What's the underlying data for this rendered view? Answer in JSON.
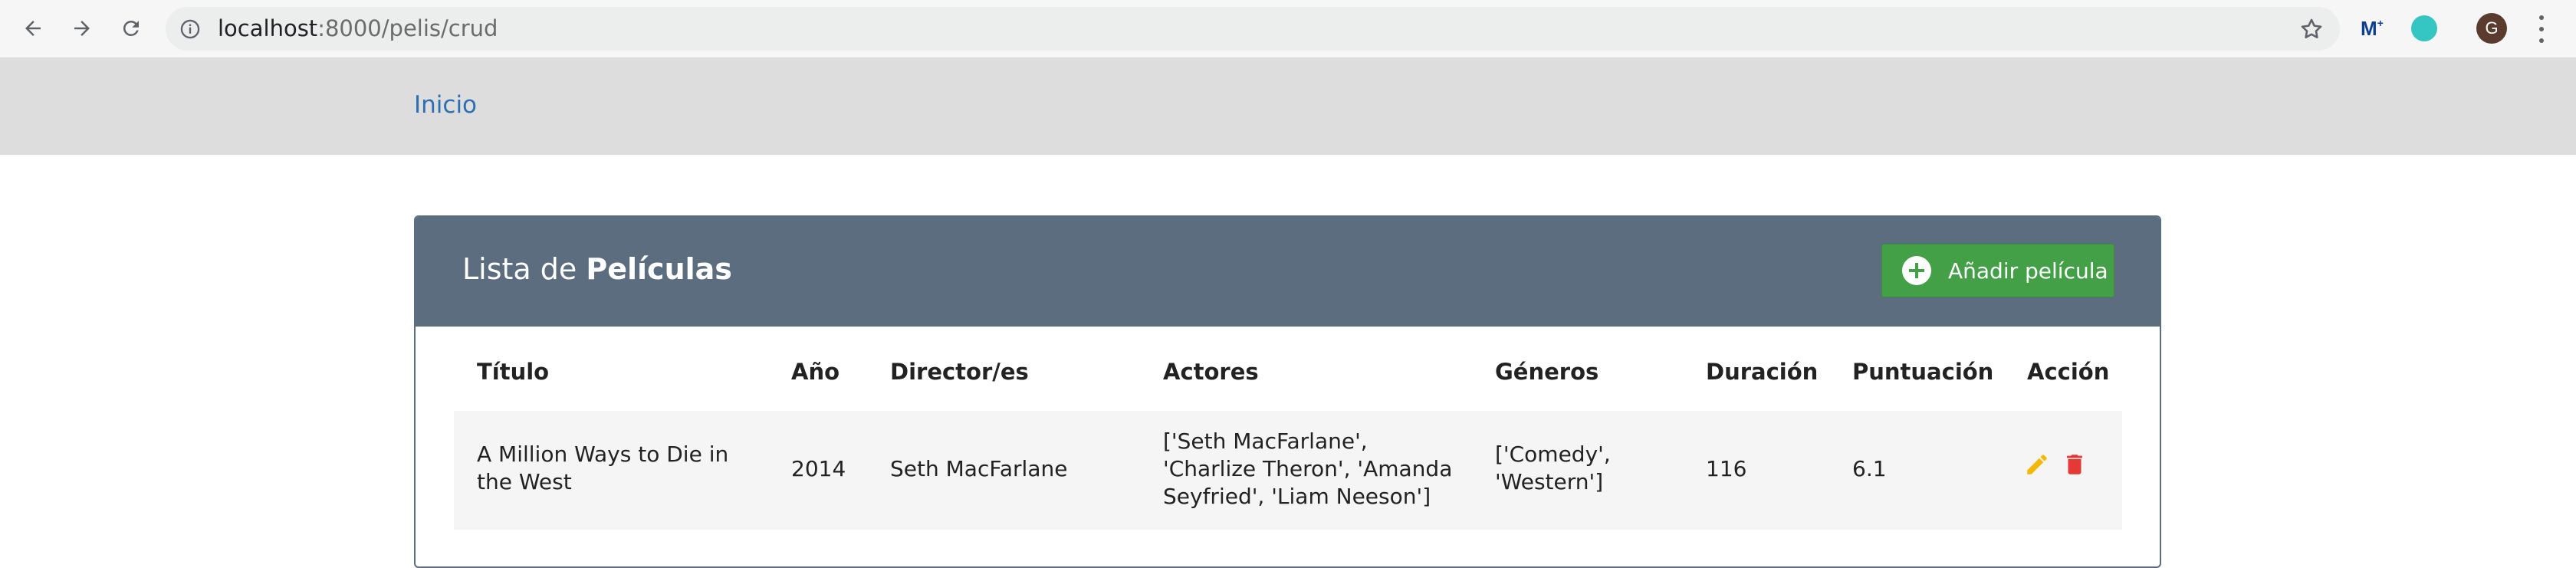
{
  "browser": {
    "url_host": "localhost",
    "url_path": ":8000/pelis/crud",
    "avatar_letter": "G"
  },
  "navbar": {
    "home_link": "Inicio"
  },
  "card": {
    "title_prefix": "Lista de ",
    "title_bold": "Películas",
    "add_button": "Añadir película"
  },
  "table": {
    "headers": [
      "Título",
      "Año",
      "Director/es",
      "Actores",
      "Géneros",
      "Duración",
      "Puntuación",
      "Acción"
    ],
    "rows": [
      {
        "titulo": "A Million Ways to Die in the West",
        "anio": "2014",
        "director": "Seth MacFarlane",
        "actores": "['Seth MacFarlane', 'Charlize Theron', 'Amanda Seyfried', 'Liam Neeson']",
        "generos": "['Comedy', 'Western']",
        "duracion": "116",
        "puntuacion": "6.1"
      }
    ]
  },
  "colors": {
    "header": "#5d6d80",
    "add_button": "#43a047",
    "edit_icon": "#f5b800",
    "delete_icon": "#e53935",
    "link": "#2d6fb3"
  }
}
